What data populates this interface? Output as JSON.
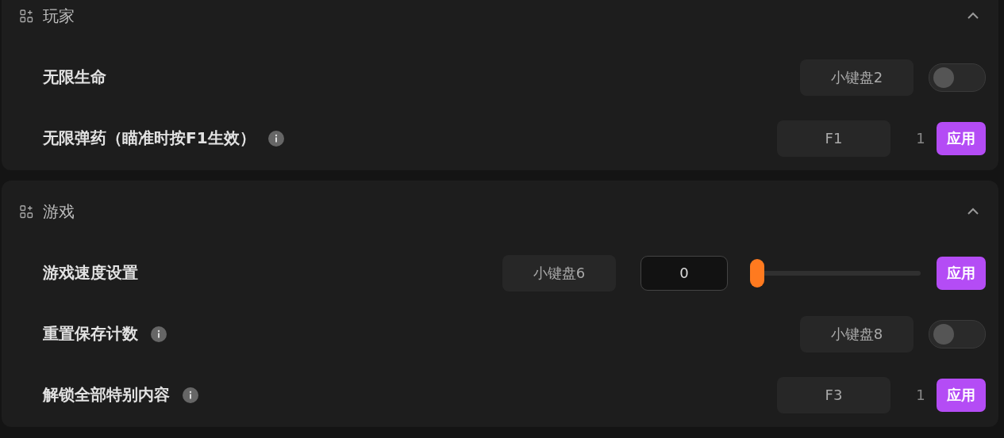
{
  "sections": [
    {
      "title": "玩家",
      "expanded": true,
      "rows": [
        {
          "kind": "toggle",
          "label": "无限生命",
          "info": false,
          "hotkey": "小键盘2",
          "on": false
        },
        {
          "kind": "apply",
          "label": "无限弹药（瞄准时按F1生效）",
          "info": true,
          "hotkey": "F1",
          "count": "1",
          "button": "应用"
        }
      ]
    },
    {
      "title": "游戏",
      "expanded": true,
      "rows": [
        {
          "kind": "slider",
          "label": "游戏速度设置",
          "info": false,
          "hotkey": "小键盘6",
          "value": "0",
          "level": 0,
          "button": "应用"
        },
        {
          "kind": "toggle",
          "label": "重置保存计数",
          "info": true,
          "hotkey": "小键盘8",
          "on": false
        },
        {
          "kind": "apply",
          "label": "解锁全部特别内容",
          "info": true,
          "hotkey": "F3",
          "count": "1",
          "button": "应用"
        }
      ]
    }
  ]
}
